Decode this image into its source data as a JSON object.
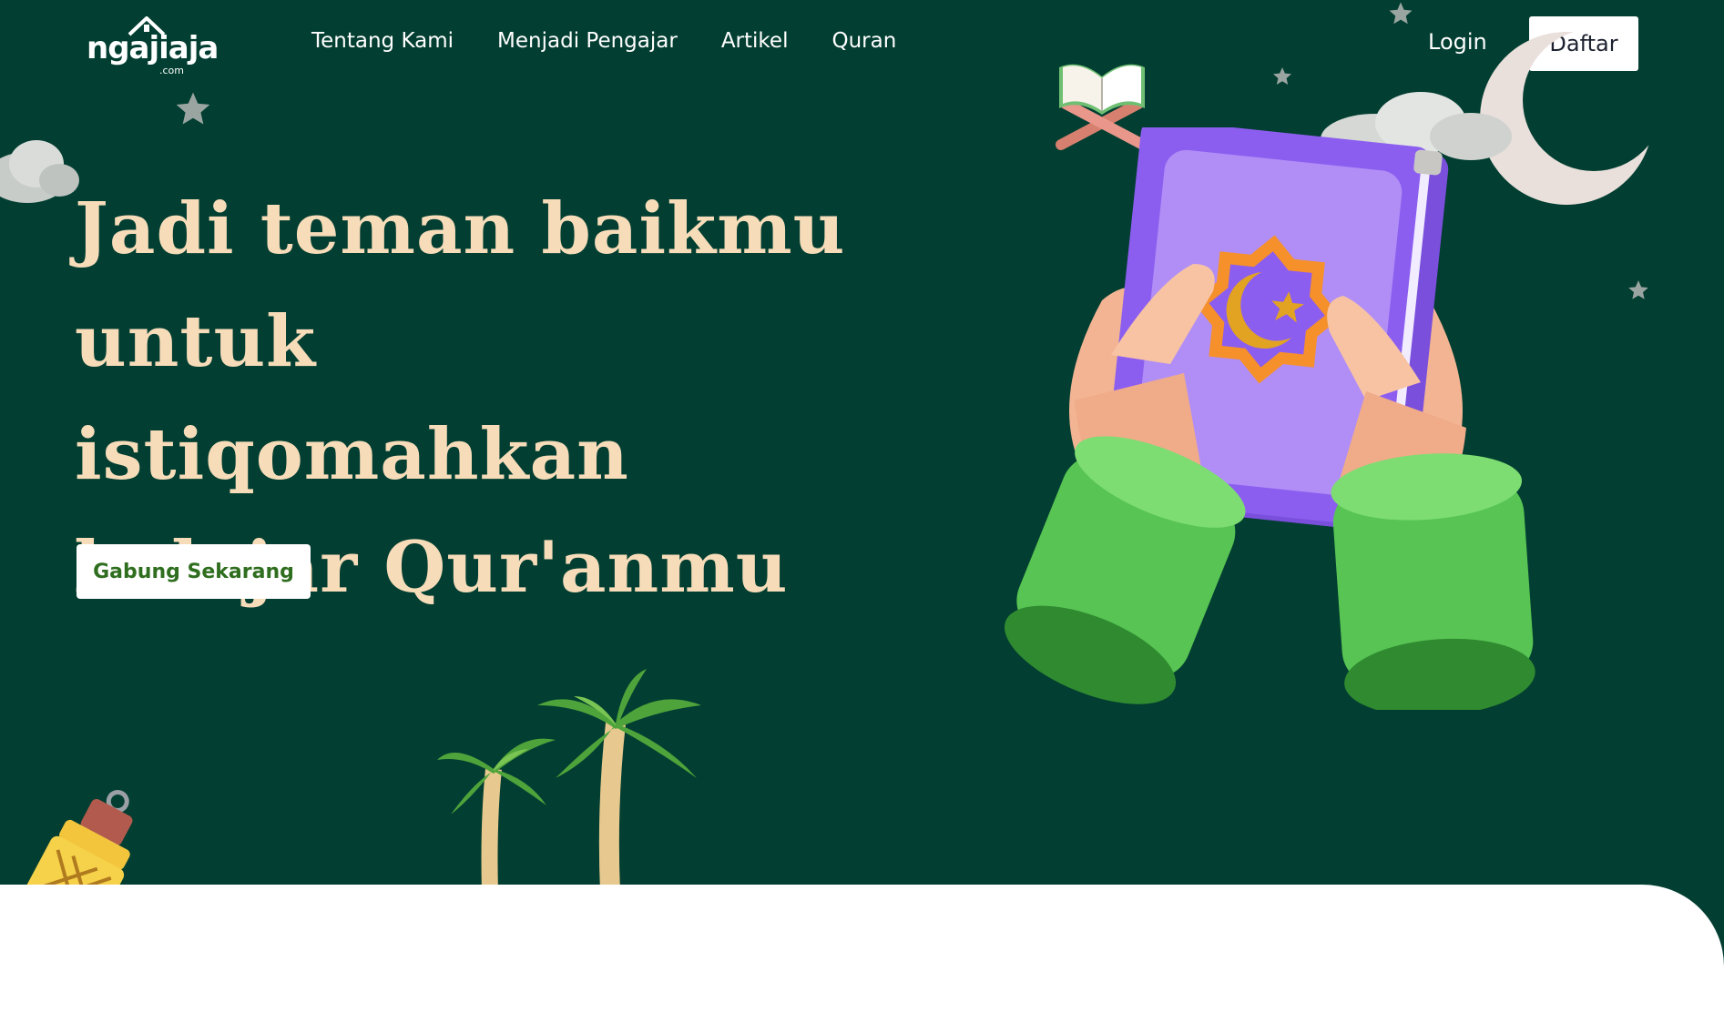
{
  "brand": {
    "name": "ngajiaja",
    "suffix": ".com"
  },
  "nav": {
    "links": [
      "Tentang Kami",
      "Menjadi Pengajar",
      "Artikel",
      "Quran"
    ],
    "login_label": "Login",
    "register_label": "Daftar"
  },
  "hero": {
    "title_lines": [
      "Jadi teman baikmu",
      "untuk istiqomahkan",
      "belajar Qur'anmu"
    ],
    "cta_label": "Gabung Sekarang"
  },
  "colors": {
    "background": "#023e31",
    "title": "#f6dcb9",
    "cta_text": "#2f6e1f",
    "white": "#ffffff"
  },
  "icons": [
    "star-icon",
    "cloud-icon",
    "crescent-moon-icon",
    "open-quran-icon",
    "quran-book-in-hands-icon",
    "palm-trees-icon",
    "lantern-icon"
  ]
}
